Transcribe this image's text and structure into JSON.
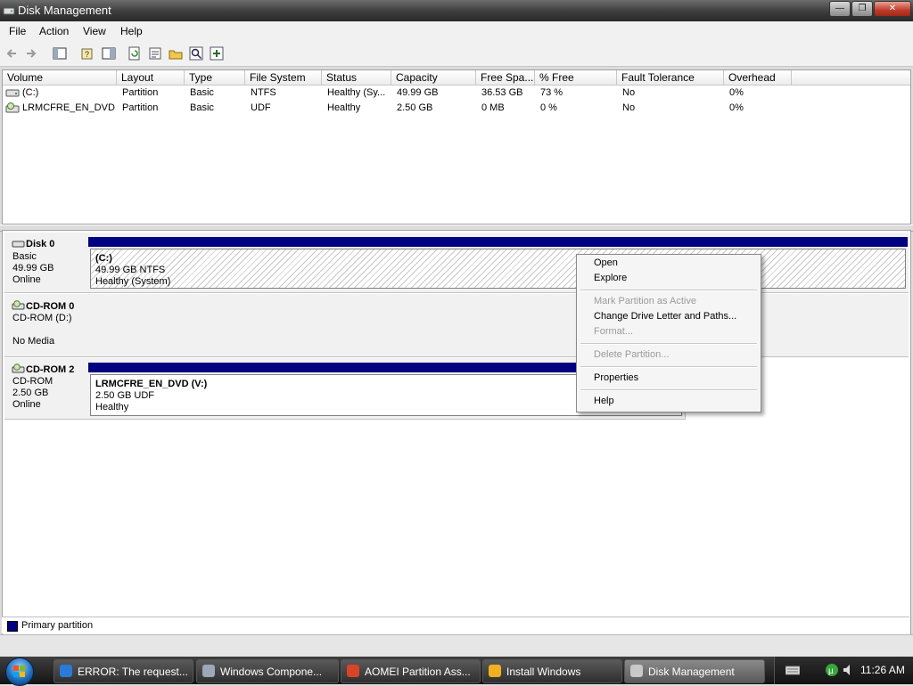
{
  "window": {
    "title": "Disk Management"
  },
  "menu": [
    "File",
    "Action",
    "View",
    "Help"
  ],
  "columns": [
    "Volume",
    "Layout",
    "Type",
    "File System",
    "Status",
    "Capacity",
    "Free Spa...",
    "% Free",
    "Fault Tolerance",
    "Overhead"
  ],
  "volumes": [
    [
      "(C:)",
      "Partition",
      "Basic",
      "NTFS",
      "Healthy (Sy...",
      "49.99 GB",
      "36.53 GB",
      "73 %",
      "No",
      "0%"
    ],
    [
      "LRMCFRE_EN_DVD ...",
      "Partition",
      "Basic",
      "UDF",
      "Healthy",
      "2.50 GB",
      "0 MB",
      "0 %",
      "No",
      "0%"
    ]
  ],
  "disks": [
    {
      "name": "Disk 0",
      "lines": [
        "Basic",
        "49.99 GB",
        "Online"
      ],
      "partition": {
        "label": "(C:)",
        "size": "49.99 GB NTFS",
        "status": "Healthy (System)"
      }
    },
    {
      "name": "CD-ROM 0",
      "lines": [
        "CD-ROM (D:)",
        "",
        "No Media"
      ]
    },
    {
      "name": "CD-ROM 2",
      "lines": [
        "CD-ROM",
        "2.50 GB",
        "Online"
      ],
      "partition": {
        "label": "LRMCFRE_EN_DVD  (V:)",
        "size": "2.50 GB UDF",
        "status": "Healthy"
      }
    }
  ],
  "legend": {
    "label": "Primary partition",
    "color": "#000080"
  },
  "context_menu": {
    "items": [
      {
        "label": "Open",
        "enabled": true
      },
      {
        "label": "Explore",
        "enabled": true
      },
      {
        "label": "Mark Partition as Active",
        "enabled": false
      },
      {
        "label": "Change Drive Letter and Paths...",
        "enabled": true
      },
      {
        "label": "Format...",
        "enabled": false
      },
      {
        "label": "Delete Partition...",
        "enabled": false
      },
      {
        "label": "Properties",
        "enabled": true
      },
      {
        "label": "Help",
        "enabled": true
      }
    ]
  },
  "taskbar": {
    "tasks": [
      {
        "label": "ERROR: The request...",
        "icon": "ie-icon"
      },
      {
        "label": "Windows Compone...",
        "icon": "windows-components-icon"
      },
      {
        "label": "AOMEI Partition Ass...",
        "icon": "aomei-icon"
      },
      {
        "label": "Install Windows",
        "icon": "windows-install-icon"
      },
      {
        "label": "Disk Management",
        "icon": "disk-management-icon",
        "active": true
      }
    ],
    "clock": "11:26 AM"
  }
}
